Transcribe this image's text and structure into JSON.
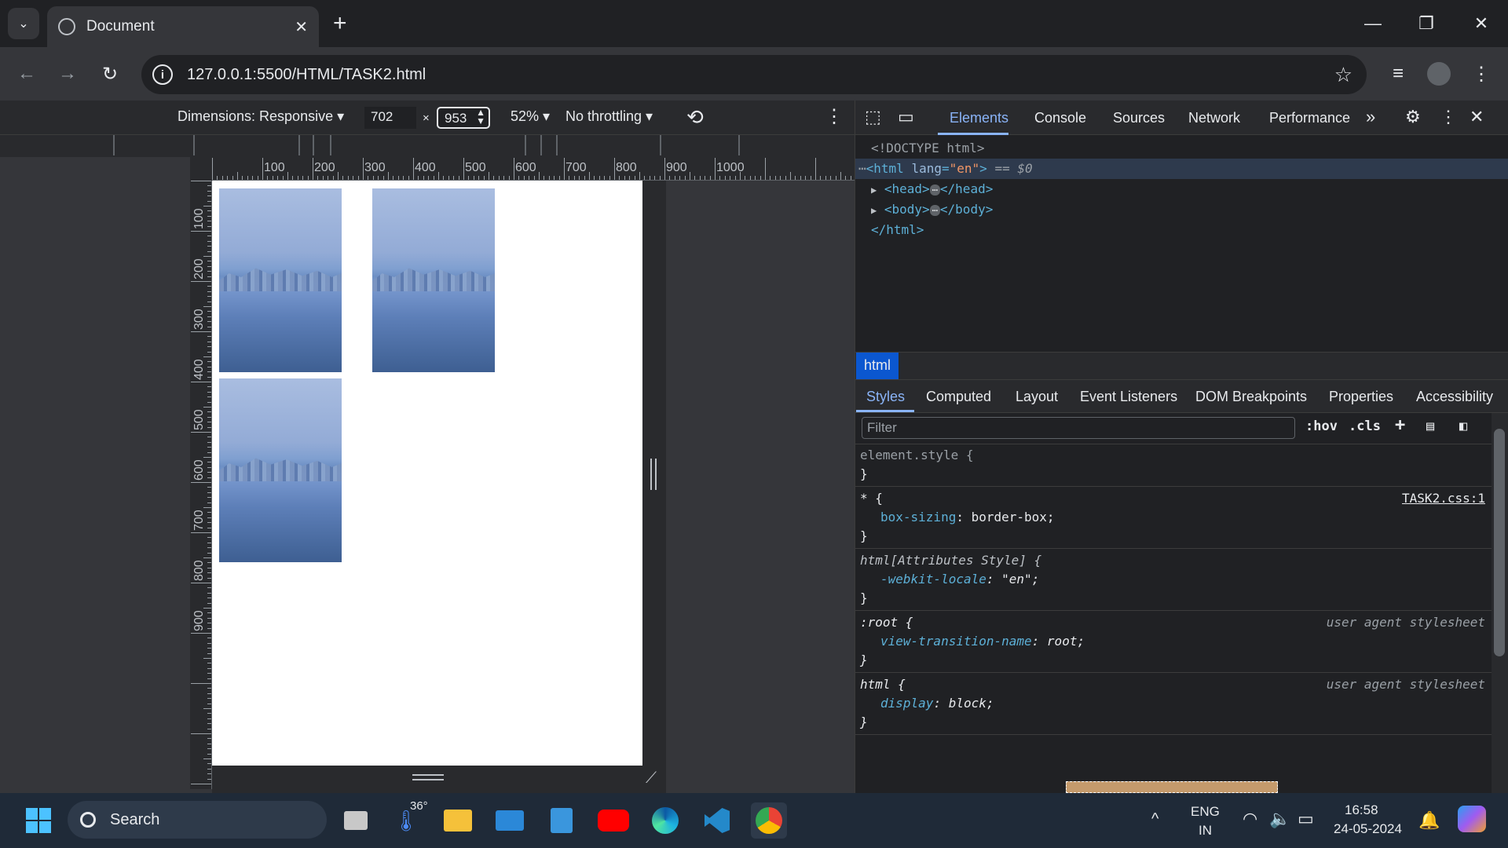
{
  "browser": {
    "tab_title": "Document",
    "tab_close": "✕",
    "new_tab": "+",
    "url": "127.0.0.1:5500/HTML/TASK2.html",
    "window_controls": [
      "—",
      "❐",
      "✕"
    ]
  },
  "device_toolbar": {
    "dimensions_label": "Dimensions: Responsive ▾",
    "width_value": "702",
    "times": "×",
    "height_value": "953",
    "zoom": "52% ▾",
    "throttling": "No throttling ▾"
  },
  "rulers": {
    "horizontal": [
      "100",
      "200",
      "300",
      "400",
      "500",
      "600",
      "700",
      "800",
      "900",
      "1000"
    ],
    "vertical": [
      "100",
      "200",
      "300",
      "400",
      "500",
      "600",
      "700",
      "800",
      "900"
    ]
  },
  "page": {
    "image_description": "lake-landscape"
  },
  "devtools": {
    "tabs": [
      "Elements",
      "Console",
      "Sources",
      "Network",
      "Performance"
    ],
    "more_tabs": "»",
    "dom": {
      "doctype": "<!DOCTYPE html>",
      "html_open": "<html",
      "lang_attr": "lang",
      "lang_val": "\"en\"",
      "html_gt": ">",
      "selected_marker": "== $0",
      "head": "<head>",
      "head_close": "</head>",
      "body": "<body>",
      "body_close": "</body>",
      "html_close": "</html>",
      "ellipsis": "⋯"
    },
    "breadcrumb": "html",
    "sub_tabs": [
      "Styles",
      "Computed",
      "Layout",
      "Event Listeners",
      "DOM Breakpoints",
      "Properties",
      "Accessibility"
    ],
    "filter_placeholder": "Filter",
    "filter_buttons": [
      ":hov",
      ".cls",
      "+"
    ],
    "rules": [
      {
        "selector": "element.style {",
        "props": [],
        "close": "}"
      },
      {
        "selector": "* {",
        "source": "TASK2.css:1",
        "props": [
          {
            "name": "box-sizing",
            "value": "border-box;"
          }
        ],
        "close": "}"
      },
      {
        "selector": "html[Attributes Style] {",
        "props": [
          {
            "name": "-webkit-locale",
            "value": "\"en\";"
          }
        ],
        "close": "}"
      },
      {
        "selector": ":root {",
        "ua": "user agent stylesheet",
        "props": [
          {
            "name": "view-transition-name",
            "value": "root;"
          }
        ],
        "close": "}"
      },
      {
        "selector": "html {",
        "ua": "user agent stylesheet",
        "props": [
          {
            "name": "display",
            "value": "block;"
          }
        ],
        "close": "}"
      }
    ]
  },
  "taskbar": {
    "search": "Search",
    "weather": "36°",
    "lang_top": "ENG",
    "lang_bottom": "IN",
    "time": "16:58",
    "date": "24-05-2024"
  },
  "colors": {
    "accent": "#8ab4f8",
    "selection": "#0b57d0",
    "tag": "#5db0d7",
    "attr_value": "#f29766"
  }
}
